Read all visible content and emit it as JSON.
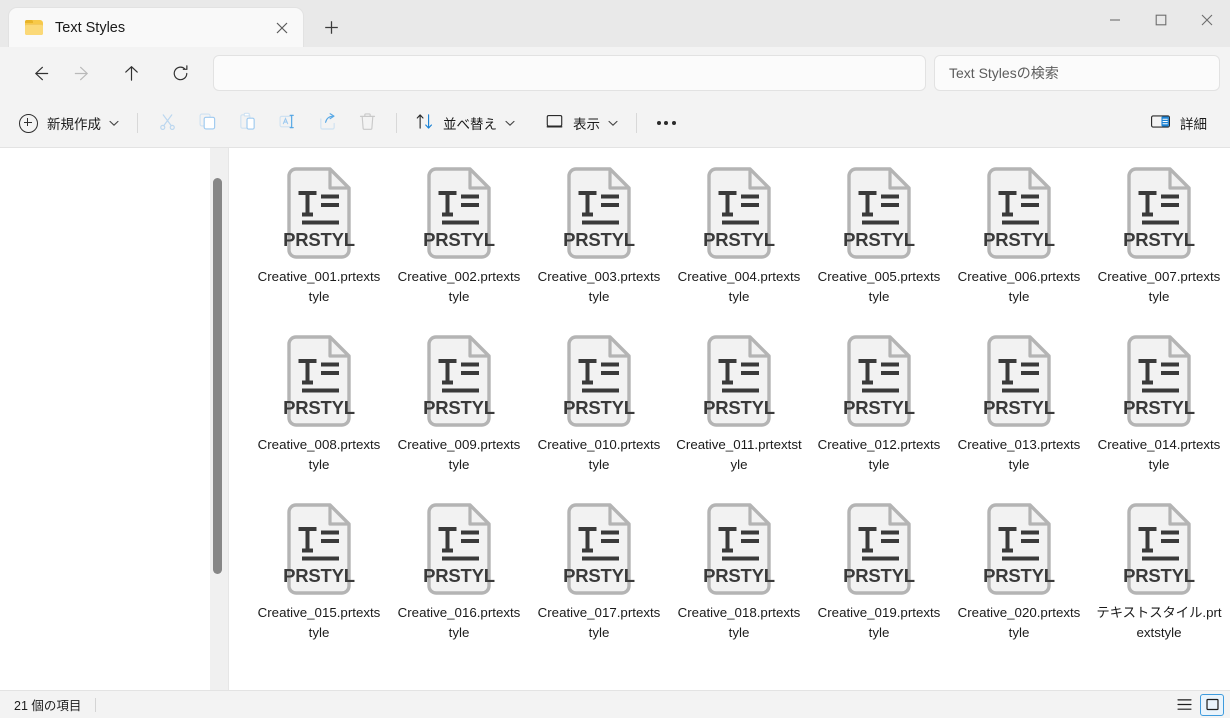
{
  "window": {
    "tab": {
      "title": "Text Styles",
      "folder_icon": "folder-icon",
      "close_icon": "close-icon"
    },
    "new_tab_icon": "plus-icon",
    "controls": {
      "minimize": "minimize-icon",
      "maximize": "maximize-icon",
      "close": "close-icon"
    }
  },
  "navigation": {
    "back": "back-arrow-icon",
    "forward": "forward-arrow-icon",
    "up": "up-arrow-icon",
    "refresh": "refresh-icon",
    "address_value": "",
    "address_placeholder": "",
    "search_placeholder": "Text Stylesの検索"
  },
  "toolbar": {
    "new_label": "新規作成",
    "new_icon": "plus-circle-icon",
    "cut_icon": "scissors-icon",
    "copy_icon": "copy-icon",
    "paste_icon": "paste-icon",
    "rename_icon": "rename-icon",
    "share_icon": "share-icon",
    "delete_icon": "trash-icon",
    "sort_label": "並べ替え",
    "sort_icon": "sort-arrows-icon",
    "view_label": "表示",
    "view_icon": "monitor-icon",
    "more_icon": "ellipsis-icon",
    "details_label": "詳細",
    "details_icon": "details-pane-icon",
    "chevron_icon": "chevron-down-icon"
  },
  "files": {
    "icon_badge": "PRSTYL",
    "icon_name": "prtextstyle-file-icon",
    "items": [
      {
        "name": "Creative_001.prtextstyle"
      },
      {
        "name": "Creative_002.prtextstyle"
      },
      {
        "name": "Creative_003.prtextstyle"
      },
      {
        "name": "Creative_004.prtextstyle"
      },
      {
        "name": "Creative_005.prtextstyle"
      },
      {
        "name": "Creative_006.prtextstyle"
      },
      {
        "name": "Creative_007.prtextstyle"
      },
      {
        "name": "Creative_008.prtextstyle"
      },
      {
        "name": "Creative_009.prtextstyle"
      },
      {
        "name": "Creative_010.prtextstyle"
      },
      {
        "name": "Creative_011.prtextstyle"
      },
      {
        "name": "Creative_012.prtextstyle"
      },
      {
        "name": "Creative_013.prtextstyle"
      },
      {
        "name": "Creative_014.prtextstyle"
      },
      {
        "name": "Creative_015.prtextstyle"
      },
      {
        "name": "Creative_016.prtextstyle"
      },
      {
        "name": "Creative_017.prtextstyle"
      },
      {
        "name": "Creative_018.prtextstyle"
      },
      {
        "name": "Creative_019.prtextstyle"
      },
      {
        "name": "Creative_020.prtextstyle"
      },
      {
        "name": "テキストスタイル.prtextstyle"
      }
    ]
  },
  "statusbar": {
    "item_count_label": "21 個の項目",
    "list_view_icon": "list-view-icon",
    "tiles_view_icon": "large-icons-view-icon",
    "active_view": "large-icons-view-icon"
  },
  "colors": {
    "accent": "#3e9bdd",
    "window_bg": "#f3f3f3",
    "content_bg": "#ffffff",
    "folder_yellow": "#f7c949"
  }
}
